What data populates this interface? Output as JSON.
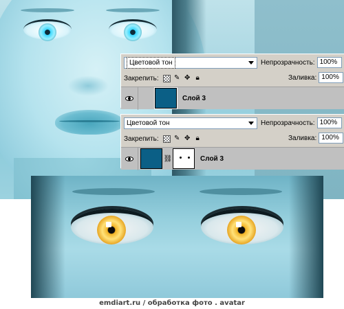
{
  "panels": [
    {
      "blend_mode": "Цветовой тон",
      "opacity_label": "Непрозрачность:",
      "opacity_value": "100%",
      "lock_label": "Закрепить:",
      "fill_label": "Заливка:",
      "fill_value": "100%",
      "layer": {
        "name": "Слой 3",
        "thumb_color": "#0b5f86",
        "has_mask": false
      }
    },
    {
      "blend_mode": "Цветовой тон",
      "opacity_label": "Непрозрачность:",
      "opacity_value": "100%",
      "lock_label": "Закрепить:",
      "fill_label": "Заливка:",
      "fill_value": "100%",
      "layer": {
        "name": "Слой 3",
        "thumb_color": "#0b5f86",
        "has_mask": true
      }
    }
  ],
  "icons": {
    "visibility": "eye-icon",
    "lock_transparency": "checkerboard-icon",
    "lock_pixels": "brush-icon",
    "lock_position": "move-icon",
    "lock_all": "padlock-icon",
    "mask_link": "chain-icon"
  },
  "caption": "emdiart.ru   / обработка фото . avatar",
  "colors": {
    "panel_bg": "#d4d0c8",
    "layer_bg": "#c0c0c0",
    "accent_layer": "#0b5f86"
  }
}
